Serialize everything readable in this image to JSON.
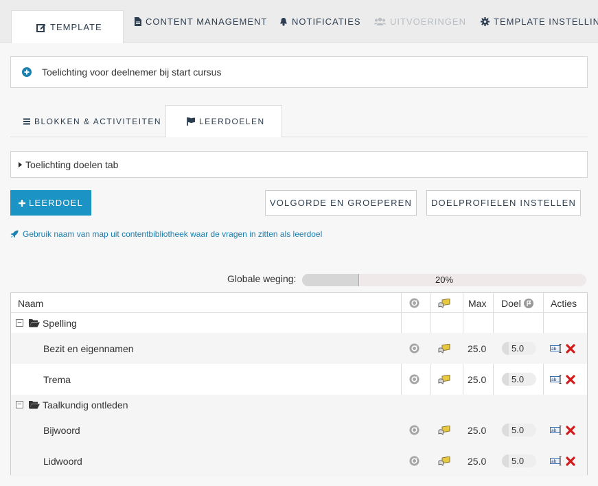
{
  "top_tabs": [
    {
      "label": "TEMPLATE",
      "icon": "edit-icon"
    },
    {
      "label": "CONTENT MANAGEMENT",
      "icon": "file-icon"
    },
    {
      "label": "NOTIFICATIES",
      "icon": "bell-icon"
    },
    {
      "label": "UITVOERINGEN",
      "icon": "users-icon"
    },
    {
      "label": "TEMPLATE INSTELLING",
      "icon": "gear-icon"
    }
  ],
  "intro_panel": {
    "label": "Toelichting voor deelnemer bij start cursus"
  },
  "sub_tabs": [
    {
      "label": "BLOKKEN & ACTIVITEITEN",
      "icon": "list-icon"
    },
    {
      "label": "LEERDOELEN",
      "icon": "flag-icon"
    }
  ],
  "goals_panel": {
    "label": "Toelichting doelen tab"
  },
  "buttons": {
    "add_goal": "LEERDOEL",
    "order_group": "VOLGORDE EN GROEPEREN",
    "profiles": "DOELPROFIELEN INSTELLEN"
  },
  "hint": "Gebruik naam van map uit contentbibliotheek waar de vragen in zitten als leerdoel",
  "global_weight": {
    "label": "Globale weging:",
    "value_text": "20%",
    "fill_percent": 20
  },
  "table": {
    "headers": {
      "name": "Naam",
      "max": "Max",
      "target": "Doel",
      "actions": "Acties"
    },
    "groups": [
      {
        "name": "Spelling",
        "rows": [
          {
            "name": "Bezit en eigennamen",
            "max": "25.0",
            "target": "5.0"
          },
          {
            "name": "Trema",
            "max": "25.0",
            "target": "5.0"
          }
        ]
      },
      {
        "name": "Taalkundig ontleden",
        "rows": [
          {
            "name": "Bijwoord",
            "max": "25.0",
            "target": "5.0"
          },
          {
            "name": "Lidwoord",
            "max": "25.0",
            "target": "5.0"
          }
        ]
      }
    ]
  }
}
